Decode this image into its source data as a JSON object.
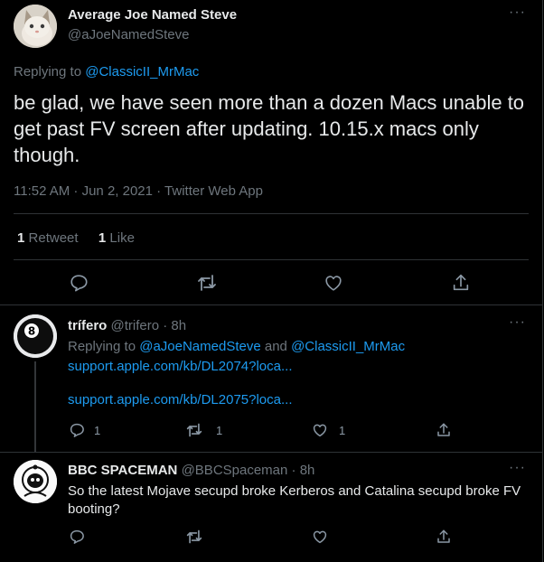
{
  "main_tweet": {
    "author_name": "Average Joe Named Steve",
    "author_handle": "@aJoeNamedSteve",
    "replying_prefix": "Replying to",
    "replying_to": "@ClassicII_MrMac",
    "text": "be glad, we have seen more than a dozen Macs unable to get past FV screen after updating. 10.15.x macs only though.",
    "timestamp": "11:52 AM · Jun 2, 2021 · Twitter Web App",
    "retweet_count": "1",
    "retweet_label": "Retweet",
    "like_count": "1",
    "like_label": "Like"
  },
  "replies": [
    {
      "author_name": "trífero",
      "author_handle": "@trifero · 8h",
      "replying_prefix": "Replying to",
      "replying_to_1": "@aJoeNamedSteve",
      "replying_and": "and",
      "replying_to_2": "@ClassicII_MrMac",
      "link1": "support.apple.com/kb/DL2074?loca...",
      "link2": "support.apple.com/kb/DL2075?loca...",
      "reply_count": "1",
      "retweet_count": "1",
      "like_count": "1"
    },
    {
      "author_name": "BBC SPACEMAN",
      "author_handle": "@BBCSpaceman · 8h",
      "text": "So the latest Mojave secupd broke Kerberos and Catalina secupd broke FV booting?"
    }
  ],
  "icons": {
    "more": "more-icon",
    "reply": "reply-icon",
    "retweet": "retweet-icon",
    "like": "like-icon",
    "share": "share-icon"
  },
  "colors": {
    "background": "#000000",
    "link": "#1d9bf0",
    "muted": "#6e767d",
    "divider": "#2f3336"
  }
}
